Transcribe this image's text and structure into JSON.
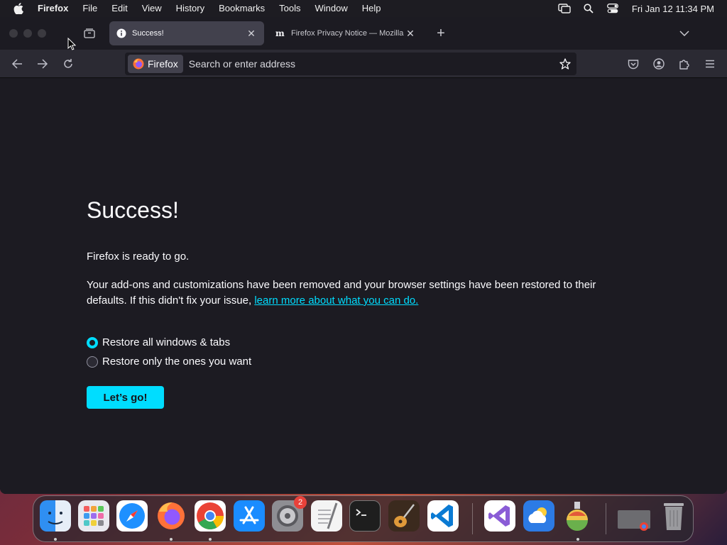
{
  "menubar": {
    "app_name": "Firefox",
    "items": [
      "File",
      "Edit",
      "View",
      "History",
      "Bookmarks",
      "Tools",
      "Window",
      "Help"
    ],
    "clock": "Fri Jan 12  11:34 PM"
  },
  "tabs": [
    {
      "title": "Success!",
      "active": true
    },
    {
      "title": "Firefox Privacy Notice — Mozilla",
      "active": false
    }
  ],
  "urlbar": {
    "identity_label": "Firefox",
    "placeholder": "Search or enter address"
  },
  "page": {
    "title": "Success!",
    "ready_text": "Firefox is ready to go.",
    "paragraph": "Your add-ons and customizations have been removed and your browser settings have been restored to their defaults. If this didn't fix your issue,",
    "link_text": "learn more about what you can do.",
    "options": [
      {
        "label": "Restore all windows & tabs",
        "checked": true
      },
      {
        "label": "Restore only the ones you want",
        "checked": false
      }
    ],
    "button_label": "Let’s go!"
  },
  "dock": {
    "apps": [
      {
        "name": "Finder",
        "color": "#2f8ff2",
        "running": true
      },
      {
        "name": "Launchpad",
        "color": "#e9e9ef",
        "running": false
      },
      {
        "name": "Safari",
        "color": "#1e90ff",
        "running": false
      },
      {
        "name": "Firefox",
        "color": "#ff7139",
        "running": true
      },
      {
        "name": "Chrome",
        "color": "#ffffff",
        "running": true
      },
      {
        "name": "App Store",
        "color": "#1a8cff",
        "running": false
      },
      {
        "name": "System Settings",
        "color": "#8e8e93",
        "running": true,
        "badge": "2"
      },
      {
        "name": "TextEdit",
        "color": "#f4f4f4",
        "running": false
      },
      {
        "name": "Terminal",
        "color": "#1e1e1e",
        "running": false
      },
      {
        "name": "GarageBand",
        "color": "#3b2a1e",
        "running": false
      },
      {
        "name": "VS Code",
        "color": "#ffffff",
        "running": false
      },
      {
        "name": "Visual Studio",
        "color": "#ffffff",
        "running": false
      },
      {
        "name": "Weather",
        "color": "#2c7be5",
        "running": false
      },
      {
        "name": "Potion",
        "color": "#6ab04c",
        "running": true
      },
      {
        "name": "Chrome Window",
        "color": "#6c6c70",
        "running": false
      },
      {
        "name": "Trash",
        "color": "#9a9a9e",
        "running": false
      }
    ]
  }
}
